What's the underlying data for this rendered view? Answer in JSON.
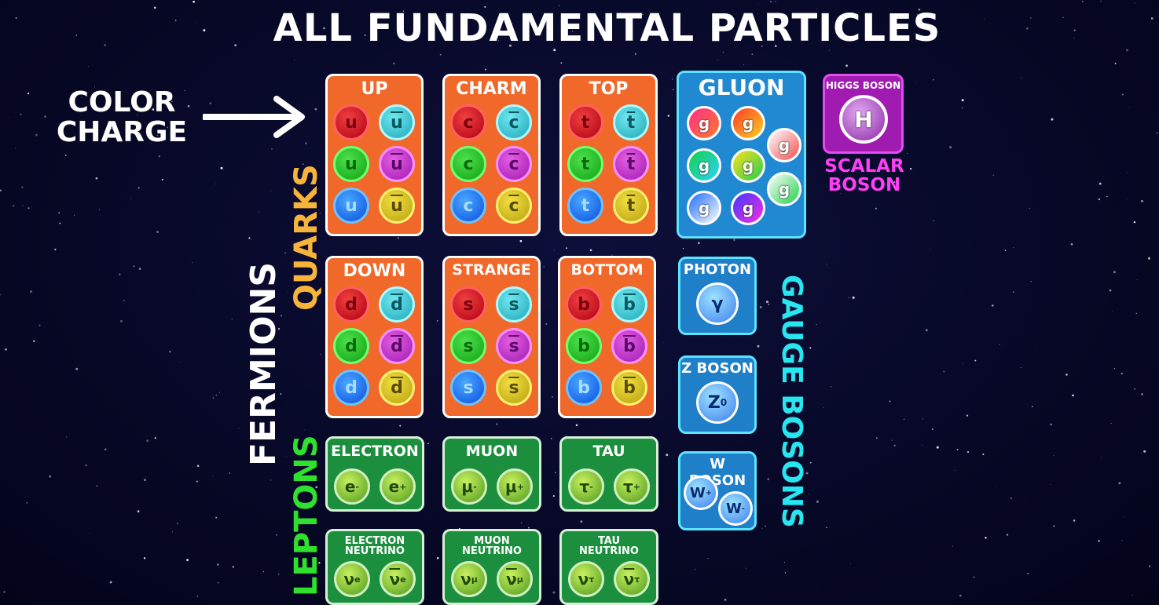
{
  "title": "ALL FUNDAMENTAL PARTICLES",
  "annotations": {
    "color_charge": "COLOR CHARGE",
    "quarks": "QUARKS",
    "fermions": "FERMIONS",
    "leptons": "LEPTONS",
    "gauge_bosons": "GAUGE BOSONS",
    "scalar_boson": "SCALAR BOSON"
  },
  "colors": {
    "quark_card": "#f0682a",
    "lepton_card": "#1c8f3e",
    "boson_card": "#1f7fc8",
    "higgs_card": "#a01cb0",
    "quarks_label": "#f7b43a",
    "leptons_label": "#2fe02f",
    "gauge_label": "#28e6f0",
    "scalar_label": "#ff3ef5"
  },
  "quarks": [
    {
      "name": "UP",
      "symbol": "u"
    },
    {
      "name": "CHARM",
      "symbol": "c"
    },
    {
      "name": "TOP",
      "symbol": "t"
    },
    {
      "name": "DOWN",
      "symbol": "d"
    },
    {
      "name": "STRANGE",
      "symbol": "s"
    },
    {
      "name": "BOTTOM",
      "symbol": "b"
    }
  ],
  "leptons": [
    {
      "name": "ELECTRON",
      "particle": "e",
      "particle_sup": "-",
      "anti": "e",
      "anti_sup": "+"
    },
    {
      "name": "MUON",
      "particle": "μ",
      "particle_sup": "-",
      "anti": "μ",
      "anti_sup": "+"
    },
    {
      "name": "TAU",
      "particle": "τ",
      "particle_sup": "-",
      "anti": "τ",
      "anti_sup": "+"
    }
  ],
  "neutrinos": [
    {
      "name_line1": "ELECTRON",
      "name_line2": "NEUTRINO",
      "symbol": "ν",
      "sub": "e"
    },
    {
      "name_line1": "MUON",
      "name_line2": "NEUTRINO",
      "symbol": "ν",
      "sub": "μ"
    },
    {
      "name_line1": "TAU",
      "name_line2": "NEUTRINO",
      "symbol": "ν",
      "sub": "τ"
    }
  ],
  "gluon": {
    "name": "GLUON",
    "symbol": "g"
  },
  "photon": {
    "name": "PHOTON",
    "symbol": "γ"
  },
  "z_boson": {
    "name": "Z BOSON",
    "symbol": "Z",
    "sup": "0"
  },
  "w_boson": {
    "name": "W BOSON",
    "symbol": "W",
    "sup_plus": "+",
    "sup_minus": "-"
  },
  "higgs": {
    "name": "HIGGS BOSON",
    "symbol": "H"
  }
}
